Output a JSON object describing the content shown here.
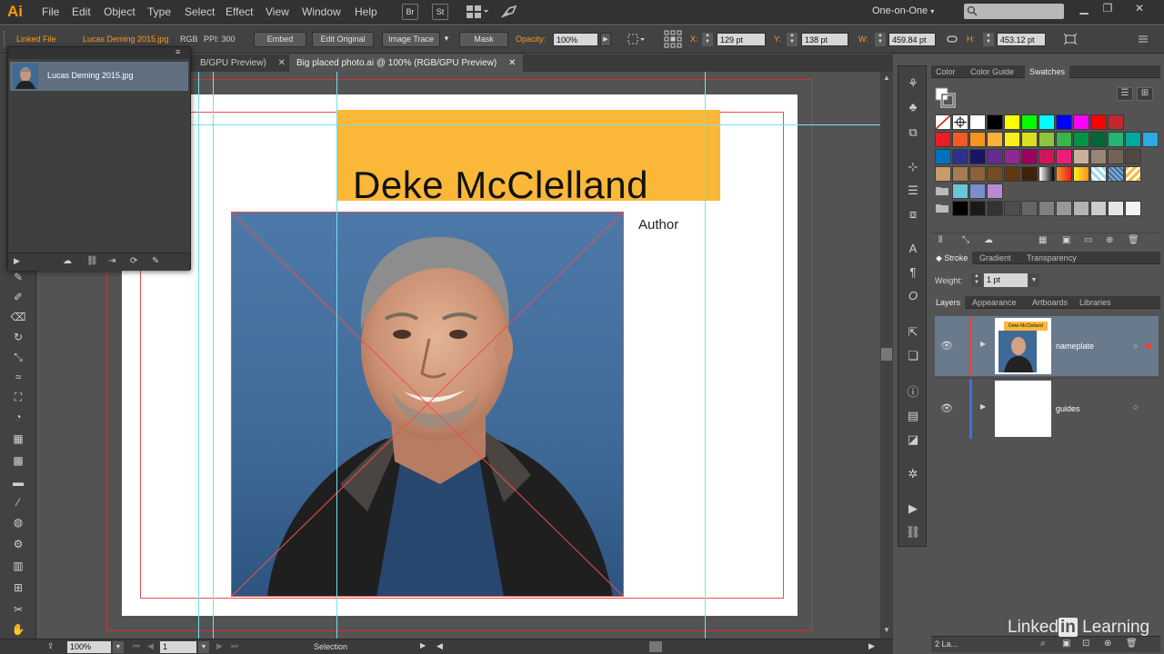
{
  "app": {
    "logo": "Ai",
    "workspace": "One-on-One",
    "workspace_caret": "▾"
  },
  "menu": [
    "File",
    "Edit",
    "Object",
    "Type",
    "Select",
    "Effect",
    "View",
    "Window",
    "Help"
  ],
  "menu_buttons": {
    "bridge": "Br",
    "stock": "St"
  },
  "control": {
    "linked_file": "Linked File",
    "file_name": "Lucas Deming 2015.jpg",
    "color_mode": "RGB",
    "ppi": "PPI: 300",
    "embed": "Embed",
    "edit_original": "Edit Original",
    "image_trace": "Image Trace",
    "mask": "Mask",
    "opacity_label": "Opacity:",
    "opacity_value": "100%",
    "x_label": "X:",
    "x_value": "129 pt",
    "y_label": "Y:",
    "y_value": "138 pt",
    "w_label": "W:",
    "w_value": "459.84 pt",
    "h_label": "H:",
    "h_value": "453.12 pt"
  },
  "tabs": [
    {
      "label": "B/GPU Preview)"
    },
    {
      "label": "Big placed photo.ai @ 100% (RGB/GPU Preview)"
    }
  ],
  "tab_close": "✕",
  "links_panel": {
    "item": "Lucas Deming 2015.jpg"
  },
  "artboard": {
    "name": "Deke McClelland",
    "role": "Author",
    "banner_color": "#fbb838"
  },
  "right_tabs_top": [
    "Color",
    "Color Guide",
    "Swatches"
  ],
  "stroke_tabs": [
    "Stroke",
    "Gradient",
    "Transparency"
  ],
  "stroke": {
    "weight_label": "Weight:",
    "weight_value": "1 pt"
  },
  "layer_tabs": [
    "Layers",
    "Appearance",
    "Artboards",
    "Libraries"
  ],
  "layers": [
    {
      "name": "nameplate",
      "thumb_text": "Deke McClelland",
      "color": "#e0463f"
    },
    {
      "name": "guides",
      "color": "#3f6fe0"
    }
  ],
  "layers_count": "2 La...",
  "status": {
    "zoom": "100%",
    "artboard": "1",
    "tool": "Selection"
  },
  "watermark": {
    "text1": "Linked",
    "in": "in",
    "text2": "Learning"
  },
  "swatches": [
    [
      "none",
      "reg",
      "#ffffff",
      "#000000",
      "#ffff00",
      "#00ff00",
      "#00ffff",
      "#0000ff",
      "#ff00ff",
      "#ff0000",
      "#c1272d"
    ],
    [
      "#ed1c24",
      "#f15a24",
      "#f7931e",
      "#fbb03b",
      "#fcee21",
      "#d9e021",
      "#8cc63f",
      "#39b54a",
      "#009245",
      "#006837",
      "#22b573",
      "#00a99d",
      "#29abe2"
    ],
    [
      "#0071bc",
      "#2e3192",
      "#1b1464",
      "#662d91",
      "#93278f",
      "#9e005d",
      "#d4145a",
      "#ed1e79",
      "#c7b299",
      "#998675",
      "#736357",
      "#534741"
    ],
    [
      "#c69c6d",
      "#a67c52",
      "#8c6239",
      "#754c24",
      "#603813",
      "#42210b",
      "#grad1",
      "#grad2",
      "#grad3",
      "#pat1",
      "#pat2",
      "#pat3"
    ],
    [
      "#folder",
      "#68c8d8",
      "#7a8fd0",
      "#b98ad0"
    ],
    [
      "#folder",
      "#000000",
      "#1a1a1a",
      "#333333",
      "#4d4d4d",
      "#666666",
      "#808080",
      "#999999",
      "#b3b3b3",
      "#cccccc",
      "#e6e6e6",
      "#f2f2f2"
    ]
  ]
}
